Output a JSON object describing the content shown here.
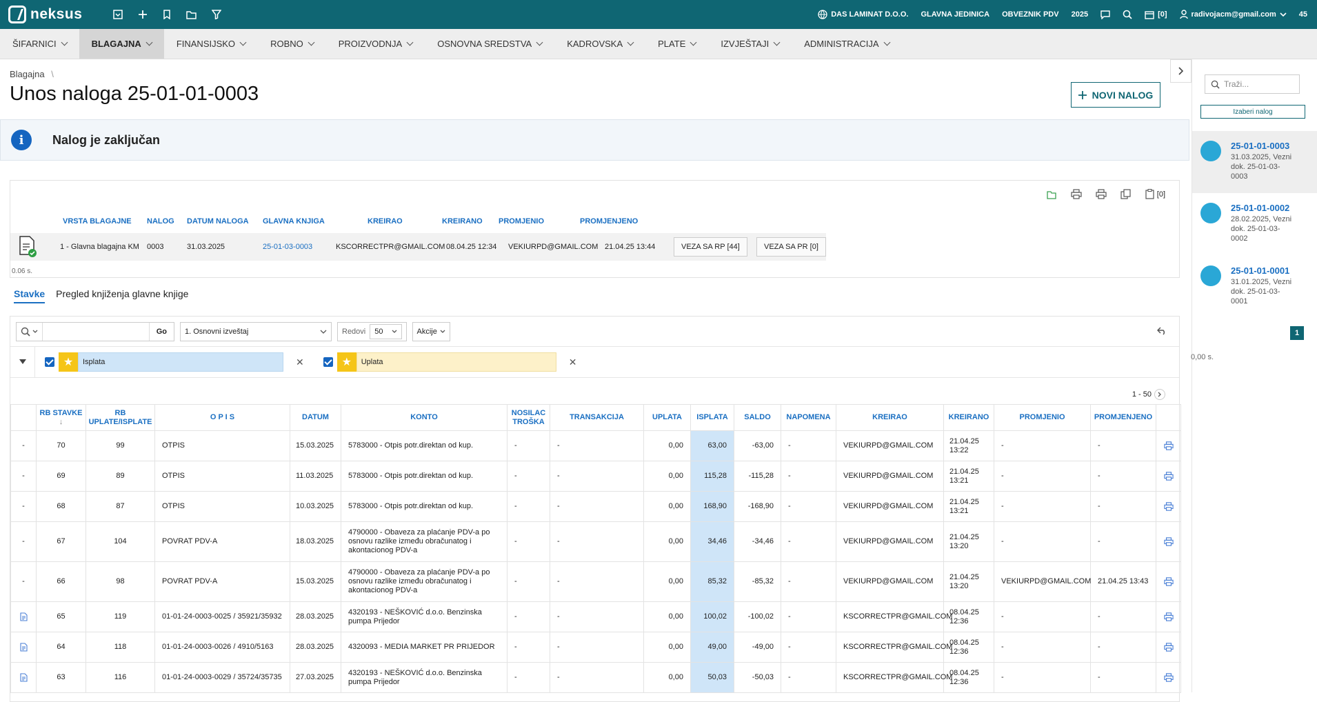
{
  "topbar": {
    "brand": "neksus",
    "company": "DAS LAMINAT D.O.O.",
    "unit": "GLAVNA JEDINICA",
    "vat": "OBVEZNIK PDV",
    "year": "2025",
    "notif_count": "[0]",
    "user": "radivojacm@gmail.com",
    "extra": "45"
  },
  "menu": [
    {
      "label": "ŠIFARNICI"
    },
    {
      "label": "BLAGAJNA"
    },
    {
      "label": "FINANSIJSKO"
    },
    {
      "label": "ROBNO"
    },
    {
      "label": "PROIZVODNJA"
    },
    {
      "label": "OSNOVNA SREDSTVA"
    },
    {
      "label": "KADROVSKA"
    },
    {
      "label": "PLATE"
    },
    {
      "label": "IZVJEŠTAJI"
    },
    {
      "label": "ADMINISTRACIJA"
    }
  ],
  "page": {
    "breadcrumb": "Blagajna",
    "breadcrumb_sep": "\\",
    "title": "Unos naloga 25-01-01-0003",
    "new_button": "NOVI NALOG",
    "info_message": "Nalog je zaključan",
    "attach_count": "[0]",
    "timing": "0.06 s."
  },
  "header": {
    "columns": [
      "VRSTA BLAGAJNE",
      "NALOG",
      "DATUM NALOGA",
      "GLAVNA KNJIGA",
      "KREIRAO",
      "KREIRANO",
      "PROMJENIO",
      "PROMJENJENO"
    ],
    "row": {
      "vrsta": "1 - Glavna blagajna KM",
      "nalog": "0003",
      "datum": "31.03.2025",
      "knjiga": "25-01-03-0003",
      "kreirao": "KSCORRECTPR@GMAIL.COM",
      "kreirano": "08.04.25 12:34",
      "promjenio": "VEKIURPD@GMAIL.COM",
      "promjenjeno": "21.04.25 13:44",
      "veza_rp": "VEZA SA RP [44]",
      "veza_pr": "VEZA SA PR [0]"
    }
  },
  "tabs": [
    {
      "label": "Stavke"
    },
    {
      "label": "Pregled knjiženja glavne knjige"
    }
  ],
  "toolbar": {
    "go": "Go",
    "report": "1. Osnovni izveštaj",
    "rows_label": "Redovi",
    "rows_value": "50",
    "actions": "Akcije"
  },
  "filters": [
    {
      "label": "Isplata",
      "color": "#cfe5f8"
    },
    {
      "label": "Uplata",
      "color": "#fdf1c9"
    }
  ],
  "pager": "1 - 50",
  "table": {
    "columns": [
      "",
      "RB STAVKE",
      "RB UPLATE/ISPLATE",
      "O P I S",
      "DATUM",
      "KONTO",
      "NOSILAC TROŠKA",
      "TRANSAKCIJA",
      "UPLATA",
      "ISPLATA",
      "SALDO",
      "NAPOMENA",
      "KREIRAO",
      "KREIRANO",
      "PROMJENIO",
      "PROMJENJENO",
      ""
    ],
    "rows": [
      {
        "lead": "-",
        "rb": "70",
        "rbu": "99",
        "opis": "OTPIS",
        "datum": "15.03.2025",
        "konto": "5783000 - Otpis potr.direktan od kup.",
        "nos": "-",
        "tr": "-",
        "upl": "0,00",
        "isp": "63,00",
        "saldo": "-63,00",
        "nap": "-",
        "kreirao": "VEKIURPD@GMAIL.COM",
        "kreirano": "21.04.25 13:22",
        "promjenio": "-",
        "promjenjeno": "-"
      },
      {
        "lead": "-",
        "rb": "69",
        "rbu": "89",
        "opis": "OTPIS",
        "datum": "11.03.2025",
        "konto": "5783000 - Otpis potr.direktan od kup.",
        "nos": "-",
        "tr": "-",
        "upl": "0,00",
        "isp": "115,28",
        "saldo": "-115,28",
        "nap": "-",
        "kreirao": "VEKIURPD@GMAIL.COM",
        "kreirano": "21.04.25 13:21",
        "promjenio": "-",
        "promjenjeno": "-"
      },
      {
        "lead": "-",
        "rb": "68",
        "rbu": "87",
        "opis": "OTPIS",
        "datum": "10.03.2025",
        "konto": "5783000 - Otpis potr.direktan od kup.",
        "nos": "-",
        "tr": "-",
        "upl": "0,00",
        "isp": "168,90",
        "saldo": "-168,90",
        "nap": "-",
        "kreirao": "VEKIURPD@GMAIL.COM",
        "kreirano": "21.04.25 13:21",
        "promjenio": "-",
        "promjenjeno": "-"
      },
      {
        "lead": "-",
        "rb": "67",
        "rbu": "104",
        "opis": "POVRAT PDV-A",
        "datum": "18.03.2025",
        "konto": "4790000 - Obaveza za plaćanje PDV-a po osnovu razlike između obračunatog i akontacionog PDV-a",
        "nos": "-",
        "tr": "-",
        "upl": "0,00",
        "isp": "34,46",
        "saldo": "-34,46",
        "nap": "-",
        "kreirao": "VEKIURPD@GMAIL.COM",
        "kreirano": "21.04.25 13:20",
        "promjenio": "-",
        "promjenjeno": "-"
      },
      {
        "lead": "-",
        "rb": "66",
        "rbu": "98",
        "opis": "POVRAT PDV-A",
        "datum": "15.03.2025",
        "konto": "4790000 - Obaveza za plaćanje PDV-a po osnovu razlike između obračunatog i akontacionog PDV-a",
        "nos": "-",
        "tr": "-",
        "upl": "0,00",
        "isp": "85,32",
        "saldo": "-85,32",
        "nap": "-",
        "kreirao": "VEKIURPD@GMAIL.COM",
        "kreirano": "21.04.25 13:20",
        "promjenio": "VEKIURPD@GMAIL.COM",
        "promjenjeno": "21.04.25 13:43"
      },
      {
        "lead": "doc",
        "rb": "65",
        "rbu": "119",
        "opis": "01-01-24-0003-0025 / 35921/35932",
        "datum": "28.03.2025",
        "konto": "4320193 - NEŠKOVIĆ d.o.o. Benzinska pumpa Prijedor",
        "nos": "-",
        "tr": "-",
        "upl": "0,00",
        "isp": "100,02",
        "saldo": "-100,02",
        "nap": "-",
        "kreirao": "KSCORRECTPR@GMAIL.COM",
        "kreirano": "08.04.25 12:36",
        "promjenio": "-",
        "promjenjeno": "-"
      },
      {
        "lead": "doc",
        "rb": "64",
        "rbu": "118",
        "opis": "01-01-24-0003-0026 / 4910/5163",
        "datum": "28.03.2025",
        "konto": "4320093 - MEDIA MARKET PR PRIJEDOR",
        "nos": "-",
        "tr": "-",
        "upl": "0,00",
        "isp": "49,00",
        "saldo": "-49,00",
        "nap": "-",
        "kreirao": "KSCORRECTPR@GMAIL.COM",
        "kreirano": "08.04.25 12:36",
        "promjenio": "-",
        "promjenjeno": "-"
      },
      {
        "lead": "doc",
        "rb": "63",
        "rbu": "116",
        "opis": "01-01-24-0003-0029 / 35724/35735",
        "datum": "27.03.2025",
        "konto": "4320193 - NEŠKOVIĆ d.o.o. Benzinska pumpa Prijedor",
        "nos": "-",
        "tr": "-",
        "upl": "0,00",
        "isp": "50,03",
        "saldo": "-50,03",
        "nap": "-",
        "kreirao": "KSCORRECTPR@GMAIL.COM",
        "kreirano": "08.04.25 12:36",
        "promjenio": "-",
        "promjenjeno": "-"
      }
    ]
  },
  "sidebar": {
    "search_placeholder": "Traži...",
    "select_button": "Izaberi nalog",
    "items": [
      {
        "title": "25-01-01-0003",
        "desc": "31.03.2025, Vezni dok. 25-01-03-0003"
      },
      {
        "title": "25-01-01-0002",
        "desc": "28.02.2025, Vezni dok. 25-01-03-0002"
      },
      {
        "title": "25-01-01-0001",
        "desc": "31.01.2025, Vezni dok. 25-01-03-0001"
      }
    ],
    "page": "1",
    "timing": "0,00 s."
  }
}
